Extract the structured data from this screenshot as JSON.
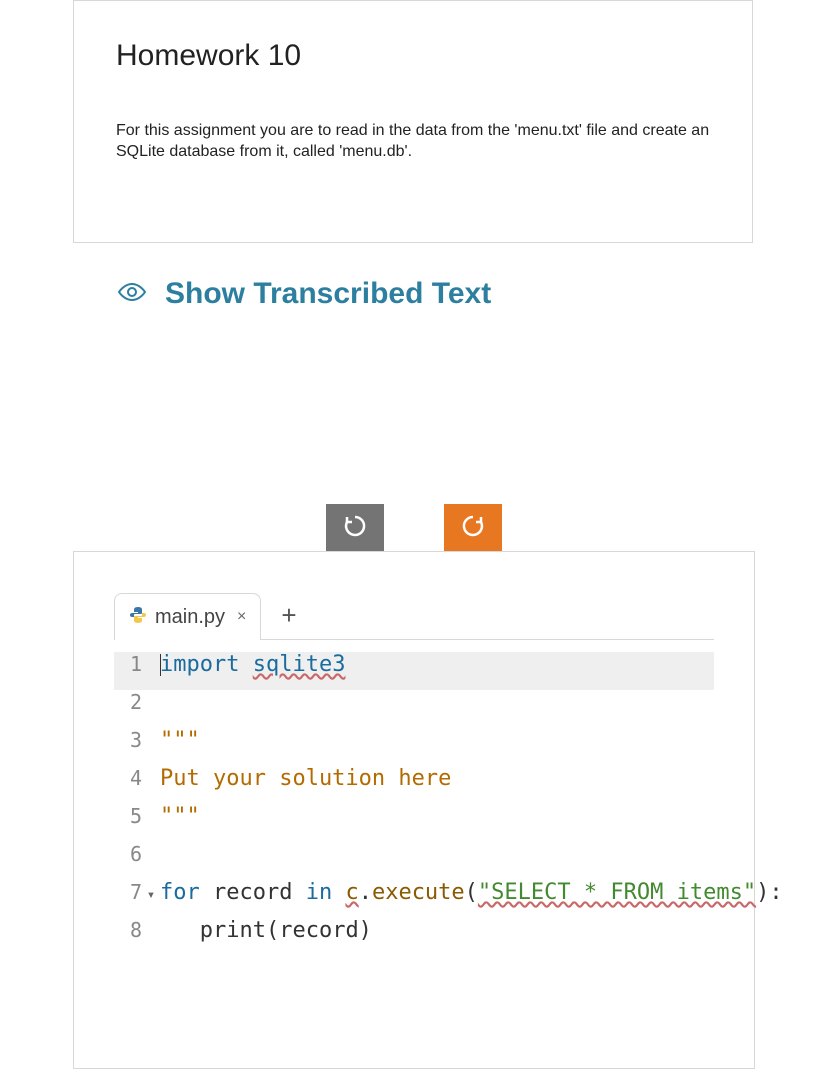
{
  "assignment": {
    "title": "Homework 10",
    "description": "For this assignment you are to read in the data from the 'menu.txt' file and create an SQLite database from it, called 'menu.db'."
  },
  "transcribed": {
    "label": "Show Transcribed Text"
  },
  "actions": {
    "undo_icon": "undo-icon",
    "redo_icon": "redo-icon"
  },
  "editor": {
    "tab": {
      "icon": "python-icon",
      "name": "main.py",
      "close": "×",
      "add": "+"
    },
    "lines": [
      {
        "num": "1",
        "fold": "",
        "tokens": [
          {
            "t": "import ",
            "c": "kw-import"
          },
          {
            "t": "sqlite3",
            "c": "kw-module"
          }
        ],
        "highlight": true,
        "cursor": true
      },
      {
        "num": "2",
        "fold": "",
        "tokens": []
      },
      {
        "num": "3",
        "fold": "",
        "tokens": [
          {
            "t": "\"\"\"",
            "c": "kw-string"
          }
        ]
      },
      {
        "num": "4",
        "fold": "",
        "tokens": [
          {
            "t": "Put your solution here",
            "c": "kw-string"
          }
        ]
      },
      {
        "num": "5",
        "fold": "",
        "tokens": [
          {
            "t": "\"\"\"",
            "c": "kw-string"
          }
        ]
      },
      {
        "num": "6",
        "fold": "",
        "tokens": []
      },
      {
        "num": "7",
        "fold": "▾",
        "tokens": [
          {
            "t": "for ",
            "c": "kw-for"
          },
          {
            "t": "record ",
            "c": "kw-var"
          },
          {
            "t": "in ",
            "c": "kw-in"
          },
          {
            "t": "c",
            "c": "kw-obj"
          },
          {
            "t": ".",
            "c": "kw-punc"
          },
          {
            "t": "execute",
            "c": "kw-method"
          },
          {
            "t": "(",
            "c": "kw-punc"
          },
          {
            "t": "\"SELECT * FROM items\"",
            "c": "kw-sqlstr"
          },
          {
            "t": "):",
            "c": "kw-punc"
          }
        ]
      },
      {
        "num": "8",
        "fold": "",
        "tokens": [
          {
            "t": "   print",
            "c": "kw-var"
          },
          {
            "t": "(record)",
            "c": "kw-punc"
          }
        ]
      }
    ]
  }
}
